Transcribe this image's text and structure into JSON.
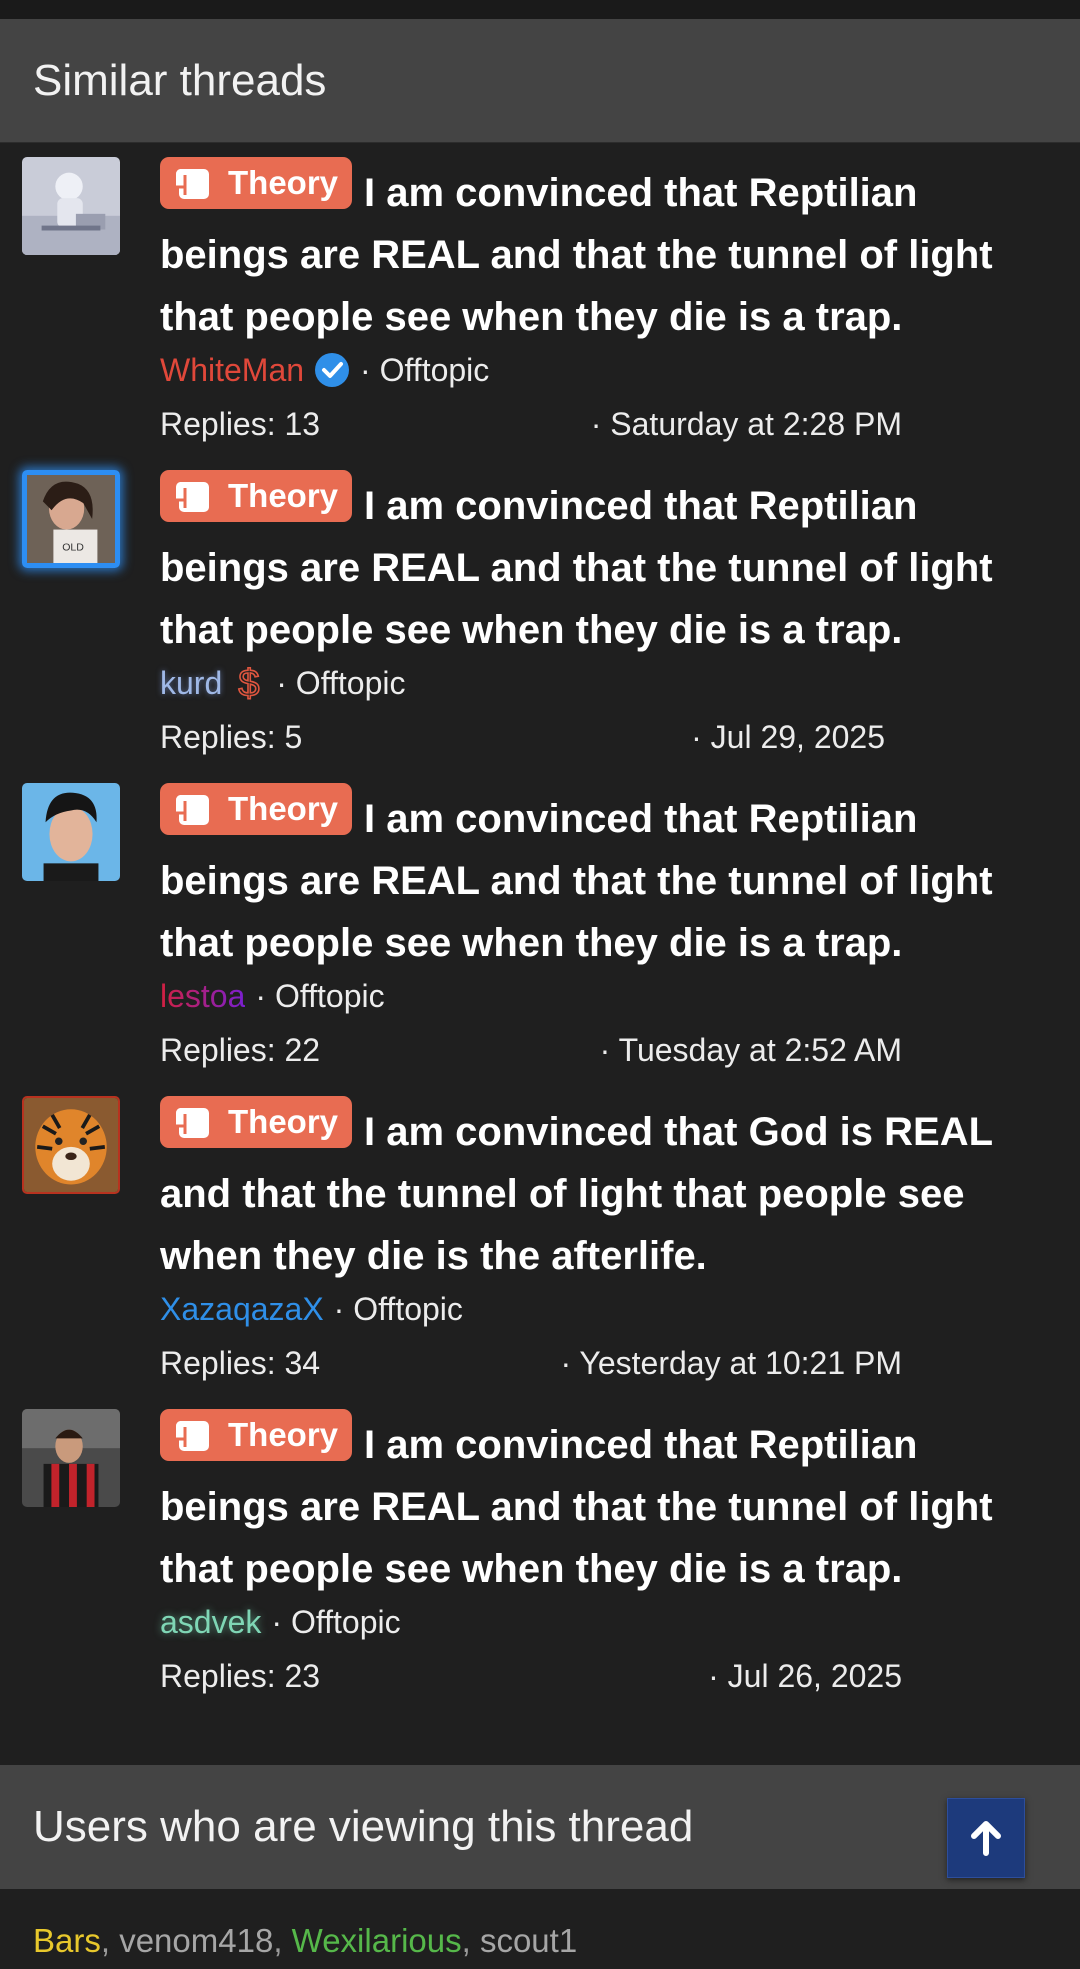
{
  "similar_threads": {
    "header": "Similar threads",
    "label": "Theory",
    "replies_prefix": "Replies: ",
    "items": [
      {
        "title": "I am convinced that Reptilian beings are REAL and that the tunnel of light that people see when they die is a trap.",
        "author": "WhiteMan",
        "forum": "Offtopic",
        "replies": "13",
        "date": "Saturday at 2:28 PM"
      },
      {
        "title": "I am convinced that Reptilian beings are REAL and that the tunnel of light that people see when they die is a trap.",
        "author": "kurd",
        "forum": "Offtopic",
        "replies": "5",
        "date": "Jul 29, 2025"
      },
      {
        "title": "I am convinced that Reptilian beings are REAL and that the tunnel of light that people see when they die is a trap.",
        "author": "lestoa",
        "forum": "Offtopic",
        "replies": "22",
        "date": "Tuesday at 2:52 AM"
      },
      {
        "title": "I am convinced that God is REAL and that the tunnel of light that people see when they die is the afterlife.",
        "author": "XazaqazaX",
        "forum": "Offtopic",
        "replies": "34",
        "date": "Yesterday at 10:21 PM"
      },
      {
        "title": "I am convinced that Reptilian beings are REAL and that the tunnel of light that people see when they die is a trap.",
        "author": "asdvek",
        "forum": "Offtopic",
        "replies": "23",
        "date": "Jul 26, 2025"
      }
    ]
  },
  "viewers": {
    "header": "Users who are viewing this thread",
    "users": [
      "Bars",
      "venom418",
      "Wexilarious",
      "scout1"
    ],
    "separator": ", "
  },
  "colors": {
    "label_bg": "#e86c52",
    "header_bg": "#444444",
    "page_bg": "#1f1f1f",
    "scroll_button_bg": "#1d3a7c"
  },
  "icons": {
    "label": "scroll-icon",
    "verified": "verified-badge-icon",
    "donor": "dollar-sign-icon",
    "scroll_top": "arrow-up-icon"
  }
}
